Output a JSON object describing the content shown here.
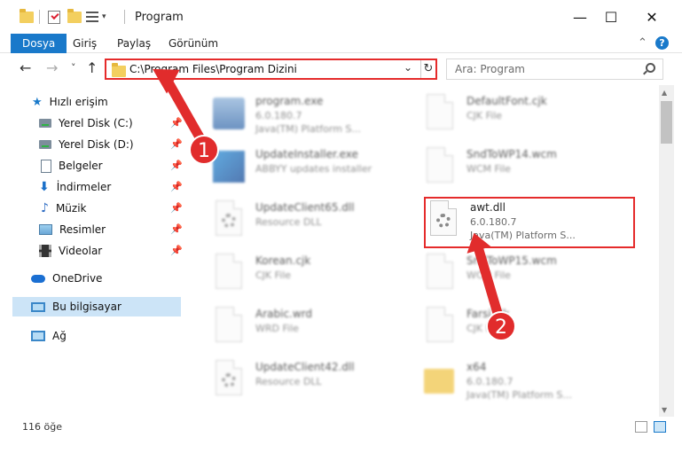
{
  "window": {
    "title": "Program",
    "min_glyph": "—",
    "max_glyph": "☐",
    "close_glyph": "✕"
  },
  "ribbon": {
    "tabs": [
      "Dosya",
      "Giriş",
      "Paylaş",
      "Görünüm"
    ],
    "active_tab": "Dosya",
    "help_glyph": "?",
    "collapse_glyph": "⌃"
  },
  "nav": {
    "back_glyph": "←",
    "forward_glyph": "→",
    "recent_glyph": "˅",
    "up_glyph": "↑"
  },
  "address": {
    "path": "C:\\Program Files\\Program Dizini",
    "dropdown_glyph": "⌄",
    "refresh_glyph": "↻"
  },
  "search": {
    "placeholder": "Ara: Program"
  },
  "sidebar": {
    "items": [
      {
        "label": "Hızlı erişim",
        "icon": "star-icon"
      },
      {
        "label": "Yerel Disk (C:)",
        "icon": "drive-icon",
        "pinned": true
      },
      {
        "label": "Yerel Disk (D:)",
        "icon": "drive-icon",
        "pinned": true
      },
      {
        "label": "Belgeler",
        "icon": "documents-icon",
        "pinned": true
      },
      {
        "label": "İndirmeler",
        "icon": "download-icon",
        "pinned": true
      },
      {
        "label": "Müzik",
        "icon": "music-icon",
        "pinned": true
      },
      {
        "label": "Resimler",
        "icon": "pictures-icon",
        "pinned": true
      },
      {
        "label": "Videolar",
        "icon": "videos-icon",
        "pinned": true
      },
      {
        "label": "OneDrive",
        "icon": "onedrive-icon"
      },
      {
        "label": "Bu bilgisayar",
        "icon": "this-pc-icon",
        "selected": true
      },
      {
        "label": "Ağ",
        "icon": "network-icon"
      }
    ],
    "pin_glyph": "📌"
  },
  "files": [
    {
      "name": "program.exe",
      "line1": "6.0.180.7",
      "line2": "Java(TM) Platform S...",
      "icon": "exe-icon"
    },
    {
      "name": "DefaultFont.cjk",
      "line1": "CJK File",
      "line2": "",
      "icon": "file-icon"
    },
    {
      "name": "UpdateInstaller.exe",
      "line1": "ABBYY updates installer",
      "line2": "",
      "icon": "installer-icon"
    },
    {
      "name": "SndToWP14.wcm",
      "line1": "WCM File",
      "line2": "",
      "icon": "file-icon"
    },
    {
      "name": "UpdateClient65.dll",
      "line1": "Resource DLL",
      "line2": "",
      "icon": "dll-icon"
    },
    {
      "name": "awt.dll",
      "line1": "6.0.180.7",
      "line2": "Java(TM) Platform S...",
      "icon": "dll-icon",
      "highlighted": true
    },
    {
      "name": "Korean.cjk",
      "line1": "CJK File",
      "line2": "",
      "icon": "file-icon"
    },
    {
      "name": "SndToWP15.wcm",
      "line1": "WCM File",
      "line2": "",
      "icon": "file-icon"
    },
    {
      "name": "Arabic.wrd",
      "line1": "WRD File",
      "line2": "",
      "icon": "file-icon"
    },
    {
      "name": "Farsi.cjk",
      "line1": "CJK File",
      "line2": "",
      "icon": "file-icon"
    },
    {
      "name": "UpdateClient42.dll",
      "line1": "Resource DLL",
      "line2": "",
      "icon": "dll-icon"
    },
    {
      "name": "x64",
      "line1": "6.0.180.7",
      "line2": "Java(TM) Platform S...",
      "icon": "folder-icon"
    }
  ],
  "status": {
    "item_count": "116 öğe"
  },
  "annotations": {
    "badge1": "1",
    "badge2": "2",
    "color": "#e12c2c"
  }
}
